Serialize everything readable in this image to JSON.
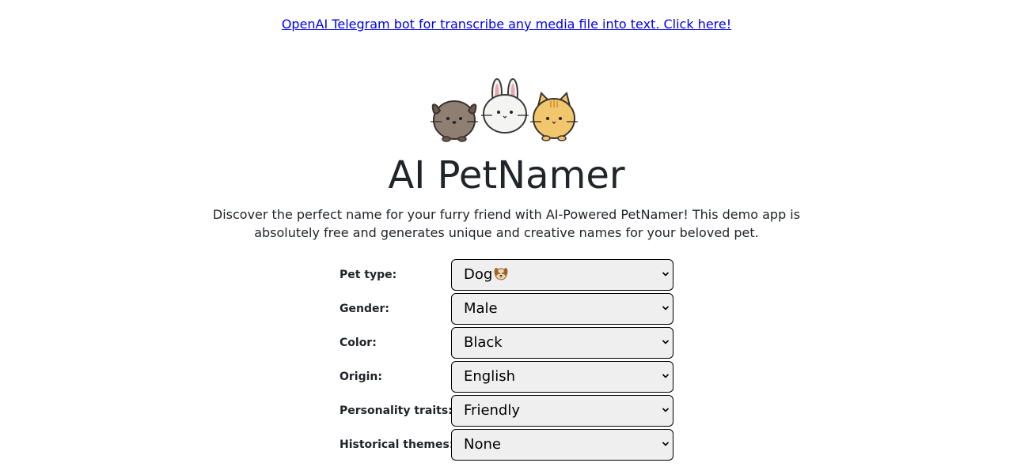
{
  "promo": {
    "link_text": "OpenAI Telegram bot for transcribe any media file into text. Click here!"
  },
  "header": {
    "title": "AI PetNamer",
    "description": "Discover the perfect name for your furry friend with AI-Powered PetNamer! This demo app is absolutely free and generates unique and creative names for your beloved pet."
  },
  "form": {
    "pet_type": {
      "label": "Pet type:",
      "value": "Dog",
      "icon": "dog-emoji-icon"
    },
    "gender": {
      "label": "Gender:",
      "value": "Male"
    },
    "color": {
      "label": "Color:",
      "value": "Black"
    },
    "origin": {
      "label": "Origin:",
      "value": "English"
    },
    "personality": {
      "label": "Personality traits:",
      "value": "Friendly"
    },
    "historical": {
      "label": "Historical themes:",
      "value": "None"
    }
  },
  "colors": {
    "link": "#0000ee",
    "text": "#212529",
    "select_bg": "#efefef",
    "select_border": "#000000"
  }
}
